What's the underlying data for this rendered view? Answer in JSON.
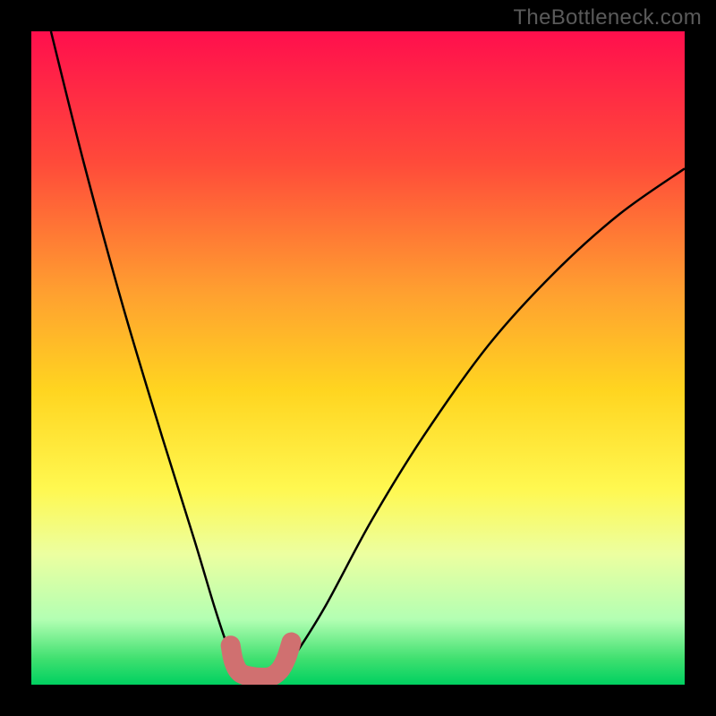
{
  "watermark": "TheBottleneck.com",
  "chart_data": {
    "type": "line",
    "title": "",
    "xlabel": "",
    "ylabel": "",
    "xlim": [
      0,
      100
    ],
    "ylim": [
      0,
      100
    ],
    "background_gradient": {
      "stops": [
        {
          "pct": 0,
          "color": "#ff0f4d"
        },
        {
          "pct": 20,
          "color": "#ff4a3a"
        },
        {
          "pct": 40,
          "color": "#ffa030"
        },
        {
          "pct": 55,
          "color": "#ffd520"
        },
        {
          "pct": 70,
          "color": "#fff850"
        },
        {
          "pct": 80,
          "color": "#ecffa0"
        },
        {
          "pct": 90,
          "color": "#b3ffb3"
        },
        {
          "pct": 96,
          "color": "#40e070"
        },
        {
          "pct": 100,
          "color": "#00d060"
        }
      ]
    },
    "series": [
      {
        "name": "bottleneck-curve",
        "color": "#000000",
        "width": 2.5,
        "points": [
          {
            "x": 3,
            "y": 100
          },
          {
            "x": 8,
            "y": 80
          },
          {
            "x": 14,
            "y": 58
          },
          {
            "x": 20,
            "y": 38
          },
          {
            "x": 25,
            "y": 22
          },
          {
            "x": 28,
            "y": 12
          },
          {
            "x": 30,
            "y": 6
          },
          {
            "x": 32,
            "y": 1.5
          },
          {
            "x": 35,
            "y": 1.0
          },
          {
            "x": 38,
            "y": 1.5
          },
          {
            "x": 40,
            "y": 4
          },
          {
            "x": 45,
            "y": 12
          },
          {
            "x": 52,
            "y": 25
          },
          {
            "x": 60,
            "y": 38
          },
          {
            "x": 70,
            "y": 52
          },
          {
            "x": 80,
            "y": 63
          },
          {
            "x": 90,
            "y": 72
          },
          {
            "x": 100,
            "y": 79
          }
        ]
      }
    ],
    "markers": [
      {
        "name": "marker-curve",
        "color": "#d07070",
        "style": "rounded-thick",
        "points": [
          {
            "x": 30.5,
            "y": 6.0
          },
          {
            "x": 31.0,
            "y": 3.5
          },
          {
            "x": 32.0,
            "y": 1.8
          },
          {
            "x": 34.0,
            "y": 1.2
          },
          {
            "x": 36.5,
            "y": 1.2
          },
          {
            "x": 38.0,
            "y": 2.2
          },
          {
            "x": 39.0,
            "y": 4.0
          },
          {
            "x": 39.8,
            "y": 6.5
          }
        ]
      }
    ]
  }
}
